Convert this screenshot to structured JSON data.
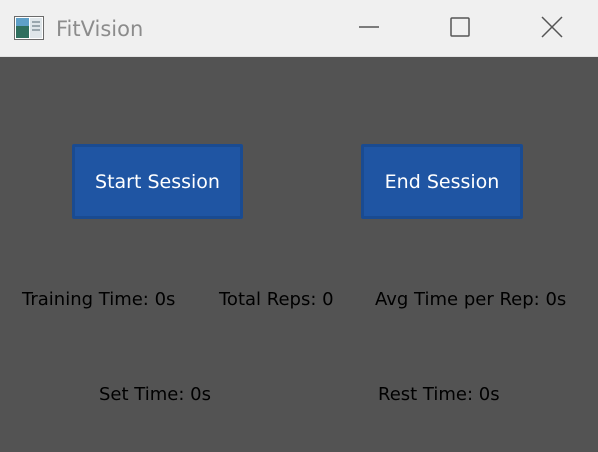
{
  "window": {
    "title": "FitVision",
    "app_icon": "app-icon",
    "controls": {
      "minimize_icon": "minimize-icon",
      "maximize_icon": "maximize-icon",
      "close_icon": "close-icon"
    }
  },
  "buttons": {
    "start_label": "Start Session",
    "end_label": "End Session"
  },
  "stats": {
    "training_time": "Training Time: 0s",
    "total_reps": "Total Reps: 0",
    "avg_time_per_rep": "Avg Time per Rep: 0s",
    "set_time": "Set Time: 0s",
    "rest_time": "Rest Time: 0s"
  },
  "colors": {
    "background": "#535353",
    "titlebar": "#f0f0f0",
    "button": "#1f55a3",
    "button_text": "#ffffff",
    "stat_text": "#000000"
  }
}
